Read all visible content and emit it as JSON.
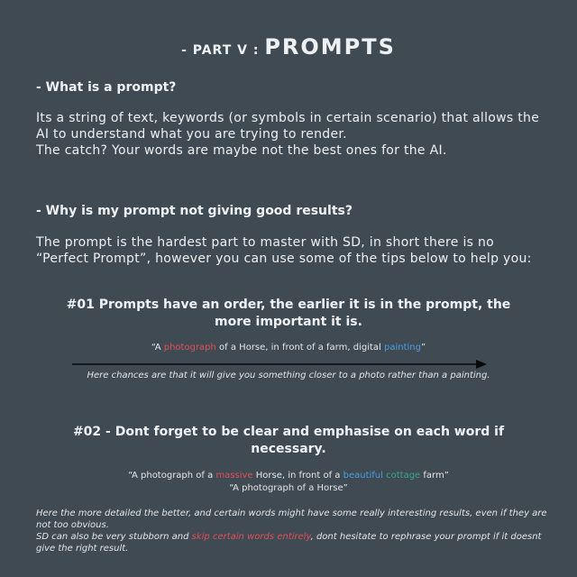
{
  "header": {
    "prefix": "- PART V : ",
    "title": "PROMPTS"
  },
  "q1": {
    "question": "- What is a prompt?"
  },
  "answer1": {
    "text": "Its a string of text, keywords (or symbols in certain scenario) that allows the AI to understand what you are trying to render.",
    "catch": "The catch? Your words are maybe not the best ones for the AI."
  },
  "q2": {
    "question": "- Why is my prompt not giving good results?"
  },
  "answer2": {
    "text": "The prompt is the hardest part to master with SD, in short there is no “Perfect Prompt”, however you can use some of the tips below to help you:"
  },
  "tip1": {
    "heading": "#01    Prompts have an order, the earlier it is in the prompt, the more important it is.",
    "example_pre": "“A ",
    "example_kw1": "photograph",
    "example_mid": " of a Horse, in front of a farm, digital ",
    "example_kw2": "painting",
    "example_post": "”",
    "explanation": "Here chances are that it will give you something closer to a photo rather than a painting."
  },
  "tip2": {
    "heading": "#02 - Dont forget to be clear and emphasise on each word if necessary.",
    "ex1_pre": "“A photograph of a ",
    "ex1_kw1": "massive",
    "ex1_mid1": " Horse, in front of a ",
    "ex1_kw2": "beautiful",
    "ex1_mid2": " ",
    "ex1_kw3": "cottage",
    "ex1_post": " farm”",
    "ex2": "“A photograph of a Horse”"
  },
  "footer": {
    "line1": "Here the more detailed the better, and certain words might have some really interesting results, even if they are not too obvious.",
    "line2_pre": "SD can also be very stubborn and ",
    "line2_kw": "skip certain words entirely",
    "line2_post": ", dont hesitate to rephrase your prompt if it doesnt give the right result."
  },
  "colors": {
    "background": "#3f4a52",
    "keyword_red": "#e0505a",
    "keyword_blue": "#4a9fe0",
    "keyword_green": "#3aa58c",
    "arrow": "#0a0a0a"
  }
}
